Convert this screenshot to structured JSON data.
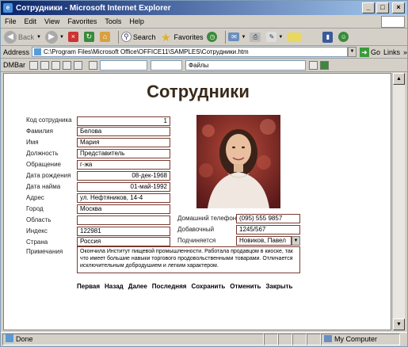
{
  "window": {
    "title": "Сотрудники - Microsoft Internet Explorer"
  },
  "menu": [
    "File",
    "Edit",
    "View",
    "Favorites",
    "Tools",
    "Help"
  ],
  "toolbar": {
    "back": "Back",
    "search": "Search",
    "favorites": "Favorites"
  },
  "address": {
    "label": "Address",
    "url": "C:\\Program Files\\Microsoft Office\\OFFICE11\\SAMPLES\\Сотрудники.htm",
    "go": "Go",
    "links": "Links"
  },
  "dmbar": {
    "label": "DMBar",
    "combo": "Файлы"
  },
  "page": {
    "title": "Сотрудники",
    "fields": [
      {
        "label": "Код сотрудника",
        "value": "1"
      },
      {
        "label": "Фамилия",
        "value": "Белова"
      },
      {
        "label": "Имя",
        "value": "Мария"
      },
      {
        "label": "Должность",
        "value": "Представитель"
      },
      {
        "label": "Обращение",
        "value": "г-жа"
      },
      {
        "label": "Дата рождения",
        "value": "08-дек-1968"
      },
      {
        "label": "Дата найма",
        "value": "01-май-1992"
      },
      {
        "label": "Адрес",
        "value": "ул. Нефтяников, 14-4"
      },
      {
        "label": "Город",
        "value": "Москва"
      },
      {
        "label": "Область",
        "value": ""
      },
      {
        "label": "Индекс",
        "value": "122981"
      },
      {
        "label": "Страна",
        "value": "Россия"
      }
    ],
    "right_fields": [
      {
        "label": "Домашний телефон",
        "value": "(095) 555 9857"
      },
      {
        "label": "Добавочный",
        "value": "1245/567"
      },
      {
        "label": "Подчиняется",
        "value": "Новиков, Павел"
      }
    ],
    "notes_label": "Примечания",
    "notes": "Окончила Институт пищевой промышленности. Работала продавцом в киоске, так что имеет большие навыки торгового продовольственными товарами. Отличается исключительным добродушием и легким характером.",
    "nav": [
      "Первая",
      "Назад",
      "Далее",
      "Последняя",
      "Сохранить",
      "Отменить",
      "Закрыть"
    ]
  },
  "status": {
    "done": "Done",
    "zone": "My Computer"
  }
}
